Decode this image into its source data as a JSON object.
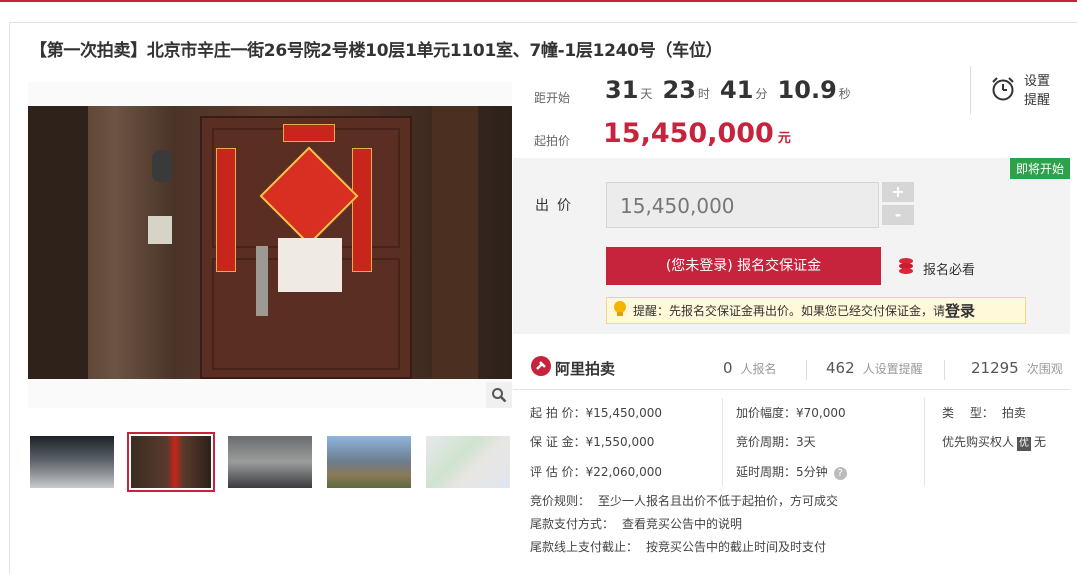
{
  "title": "【第一次拍卖】北京市辛庄一街26号院2号楼10层1单元1101室、7幢-1层1240号（车位）",
  "countdown": {
    "label": "距开始",
    "days": "31",
    "days_unit": "天",
    "hours": "23",
    "hours_unit": "时",
    "minutes": "41",
    "minutes_unit": "分",
    "seconds": "10.9",
    "seconds_unit": "秒"
  },
  "start_price": {
    "label": "起拍价",
    "value": "15,450,000",
    "unit": "元"
  },
  "remind": {
    "line1": "设置",
    "line2": "提醒",
    "icon": "alarm-clock-icon"
  },
  "bid": {
    "badge": "即将开始",
    "label": "出价",
    "input_value": "15,450,000",
    "plus": "+",
    "minus": "-",
    "signup_button": "(您未登录) 报名交保证金",
    "must_read": "报名必看",
    "tip_text": "提醒：先报名交保证金再出价。如果您已经交付保证金，请",
    "tip_login": "登录"
  },
  "stats": {
    "brand": "阿里拍卖",
    "signup_count": "0",
    "signup_label": "人报名",
    "remind_count": "462",
    "remind_label": "人设置提醒",
    "views_count": "21295",
    "views_label": "次围观"
  },
  "details": {
    "start_price_k": "起 拍 价：",
    "start_price_v": "¥15,450,000",
    "deposit_k": "保 证 金：",
    "deposit_v": "¥1,550,000",
    "appraisal_k": "评 估 价：",
    "appraisal_v": "¥22,060,000",
    "increment_k": "加价幅度：",
    "increment_v": "¥70,000",
    "period_k": "竞价周期：",
    "period_v": "3天",
    "delay_k": "延时周期：",
    "delay_v": "5分钟",
    "type_k": "类　 型：",
    "type_v": "拍卖",
    "priority_k": "优先购买权人",
    "priority_badge": "优",
    "priority_v": "无"
  },
  "rules": {
    "rule1_k": "竞价规则：",
    "rule1_v": "至少一人报名且出价不低于起拍价，方可成交",
    "rule2_k": "尾款支付方式：",
    "rule2_v": "查看竞买公告中的说明",
    "rule3_k": "尾款线上支付截止：",
    "rule3_v": "按竞买公告中的截止时间及时支付"
  },
  "colors": {
    "accent": "#c6243d",
    "badge_green": "#2ca24a",
    "tip_bg": "#fff8d9"
  }
}
